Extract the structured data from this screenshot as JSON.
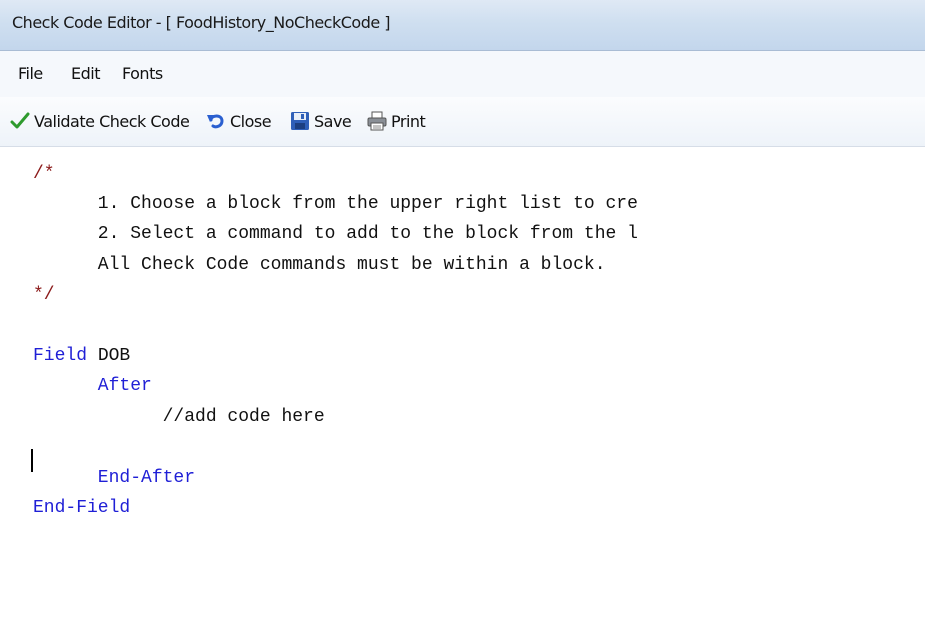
{
  "window": {
    "title": "Check Code Editor - [ FoodHistory_NoCheckCode ]"
  },
  "menu": {
    "items": [
      "File",
      "Edit",
      "Fonts"
    ]
  },
  "toolbar": {
    "validate_label": "Validate Check Code",
    "close_label": "Close",
    "save_label": "Save",
    "print_label": "Print",
    "icons": {
      "validate": "checkmark-icon",
      "close": "undo-arrow-icon",
      "save": "floppy-disk-icon",
      "print": "printer-icon"
    }
  },
  "editor": {
    "lines": [
      "/*",
      "      1. Choose a block from the upper right list to cre",
      "      2. Select a command to add to the block from the l",
      "      All Check Code commands must be within a block.",
      "*/",
      "",
      "Field DOB",
      "      After",
      "            //add code here",
      "",
      "      End-After",
      "End-Field"
    ],
    "keyword_color": "#1f1fd6",
    "comment_marker_color": "#8b1a1a"
  }
}
